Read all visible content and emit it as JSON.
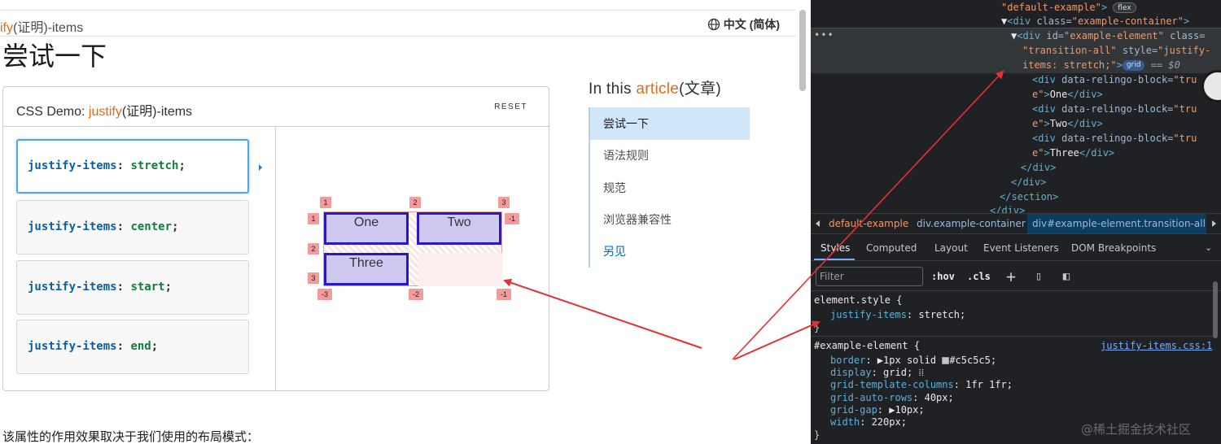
{
  "page": {
    "breadcrumb_pre": "ify",
    "breadcrumb_post": "(证明)-items",
    "language": "中文 (简体)",
    "title": "尝试一下",
    "demo": {
      "label_pre": "CSS Demo: ",
      "label_acc": "justify",
      "label_post": "(证明)-items",
      "reset": "RESET",
      "options": [
        {
          "prop": "justify-items",
          "val": "stretch"
        },
        {
          "prop": "justify-items",
          "val": "center"
        },
        {
          "prop": "justify-items",
          "val": "start"
        },
        {
          "prop": "justify-items",
          "val": "end"
        }
      ],
      "items": [
        "One",
        "Two",
        "Three"
      ],
      "grid_tags": {
        "top": [
          "1",
          "2",
          "3"
        ],
        "left": [
          "1",
          "2",
          "3"
        ],
        "right": [
          "-1"
        ],
        "bottom": [
          "-3",
          "-2",
          "-1"
        ]
      }
    },
    "toc": {
      "heading_pre": "In this ",
      "heading_acc": "article",
      "heading_post": "(文章)",
      "items": [
        "尝试一下",
        "语法规则",
        "规范",
        "浏览器兼容性",
        "另见"
      ]
    },
    "body_text": "该属性的作用效果取决于我们使用的布局模式："
  },
  "devtools": {
    "dom": {
      "line0_attr": "\"default-example\"",
      "line0_pill": "flex",
      "line1_tag": "<div ",
      "line1_attr": "class=",
      "line1_val": "\"example-container\"",
      "line1_end": ">",
      "sel_a": "<div ",
      "sel_id_attr": "id=",
      "sel_id_val": "\"example-element\"",
      "sel_class_attr": " class=",
      "sel_class_val": "\"transition-all\"",
      "sel_style_attr": " style=",
      "sel_style_val1": "\"justify-",
      "sel_style_val2": "items: stretch;\"",
      "sel_end": ">",
      "sel_pill": "grid",
      "sel_eq": "== $0",
      "child_attr": "data-relingo-block=",
      "child_val1": "\"tru",
      "child_val2": "e\"",
      "children": [
        "One",
        "Two",
        "Three"
      ],
      "close_div": "</div>",
      "close_section": "</section>",
      "close_div_partial": "</div>"
    },
    "breadcrumbs": [
      "default-example",
      "div.example-container",
      "div#example-element.transition-all"
    ],
    "tabs": [
      "Styles",
      "Computed",
      "Layout",
      "Event Listeners",
      "DOM Breakpoints"
    ],
    "filter_placeholder": "Filter",
    "hov": ":hov",
    "cls": ".cls",
    "element_style": {
      "selector": "element.style {",
      "prop": "justify-items",
      "value": "stretch",
      "close": "}"
    },
    "rule": {
      "selector": "#example-element {",
      "source": "justify-items.css:1",
      "decls": [
        {
          "prop": "border",
          "value": "1px solid",
          "color": "#c5c5c5",
          "has_toggle": true,
          "has_swatch": true
        },
        {
          "prop": "display",
          "value": "grid",
          "has_grid_icon": true
        },
        {
          "prop": "grid-template-columns",
          "value": "1fr 1fr"
        },
        {
          "prop": "grid-auto-rows",
          "value": "40px"
        },
        {
          "prop": "grid-gap",
          "value": "10px",
          "has_toggle": true
        },
        {
          "prop": "width",
          "value": "220px"
        }
      ],
      "close": "}"
    },
    "watermark": "@稀土掘金技术社区"
  },
  "colors": {
    "accent": "#e66a15",
    "link": "#0069c2",
    "grid_item_fill": "#cfc9f1",
    "grid_item_border": "#2a18c8",
    "annotation_arrow": "#e53030"
  }
}
